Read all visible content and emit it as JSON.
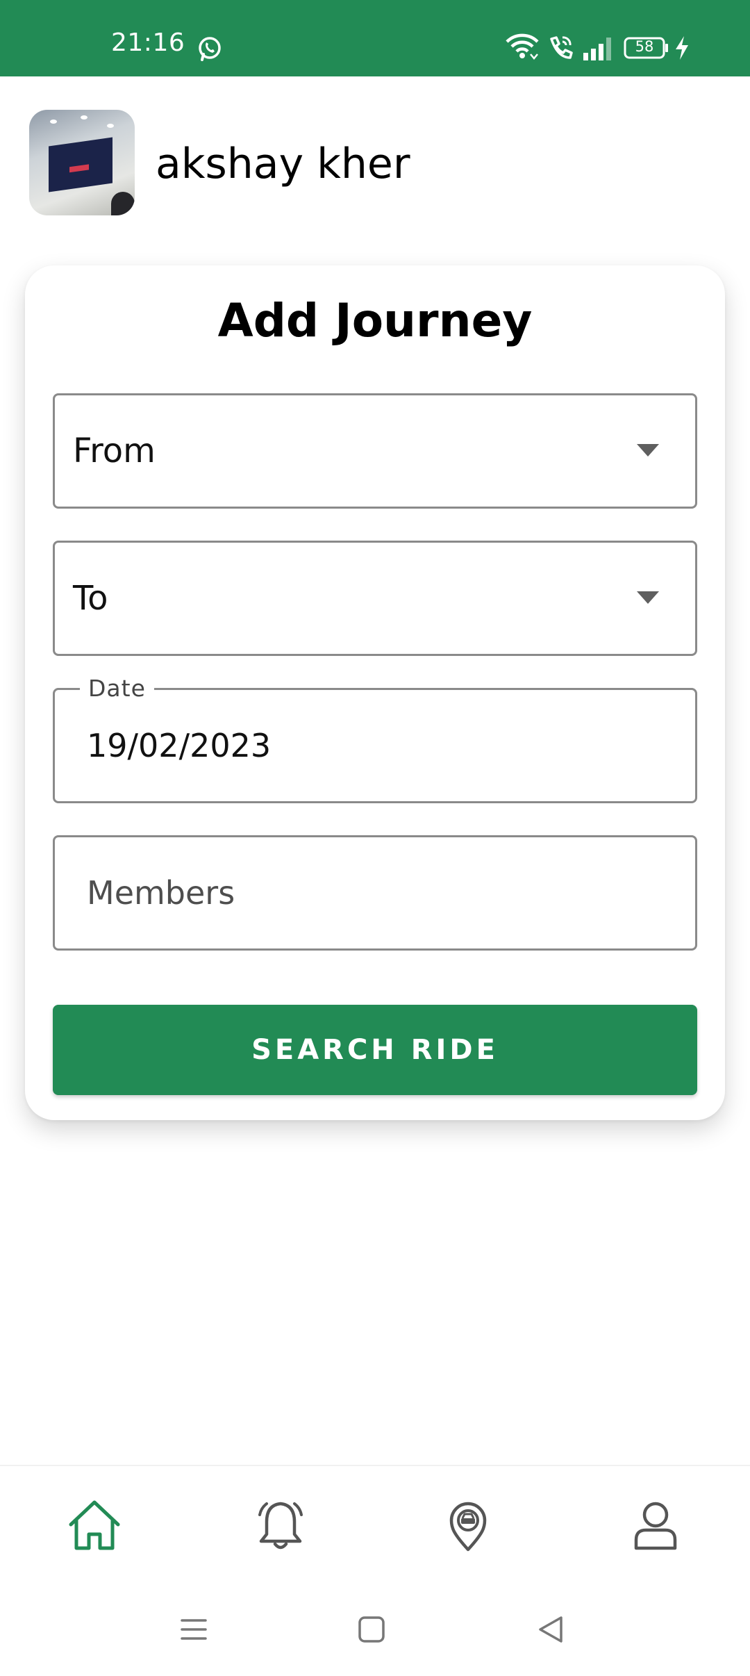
{
  "status_bar": {
    "time": "21:16",
    "battery": "58",
    "icons": [
      "whatsapp-icon",
      "wifi-icon",
      "wifi-call-icon",
      "signal-icon",
      "battery-icon",
      "charging-icon"
    ]
  },
  "profile": {
    "name": "akshay kher"
  },
  "journey_form": {
    "title": "Add Journey",
    "from_label": "From",
    "to_label": "To",
    "date_label": "Date",
    "date_value": "19/02/2023",
    "members_placeholder": "Members",
    "search_button": "SEARCH RIDE"
  },
  "bottom_nav": {
    "items": [
      {
        "icon": "home-icon",
        "active": true
      },
      {
        "icon": "bell-icon",
        "active": false
      },
      {
        "icon": "ride-location-icon",
        "active": false
      },
      {
        "icon": "user-icon",
        "active": false
      }
    ]
  },
  "colors": {
    "primary": "#228B55",
    "inactive_icon": "#555555",
    "field_border": "#8A8A8A"
  }
}
